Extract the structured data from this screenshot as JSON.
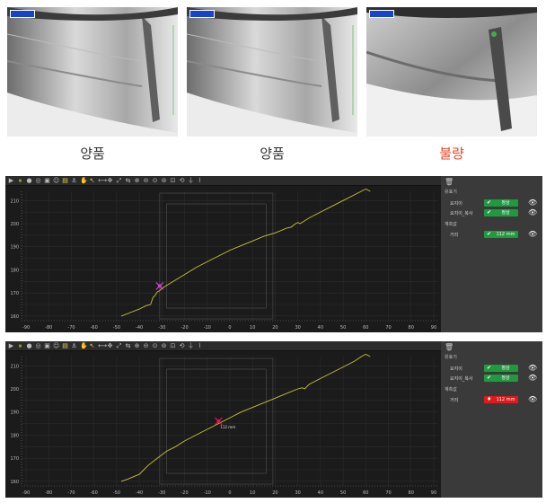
{
  "photos": [
    {
      "verdict": "양품",
      "status": "ok"
    },
    {
      "verdict": "양품",
      "status": "ok"
    },
    {
      "verdict": "불량",
      "status": "ng"
    }
  ],
  "colors": {
    "ok": "#1f9a3e",
    "ng": "#e0191c",
    "curve": "#c9c23a",
    "bad_text": "#e8472b"
  },
  "toolbar": {
    "icons": [
      "play-icon",
      "pause-icon",
      "record-icon",
      "camera-icon",
      "save-icon",
      "user-icon",
      "layout-icon",
      "anchor-icon",
      "hand-icon",
      "pointer-icon",
      "measure-icon",
      "pan-icon",
      "fit-icon",
      "align-icon",
      "zoom-in-icon",
      "zoom-out-icon",
      "zoom-x-icon",
      "zoom-y-icon",
      "zoom-box-icon",
      "zoom-reset-icon",
      "filter-icon",
      "trigger-icon"
    ]
  },
  "panels": [
    {
      "sections": {
        "detect": "유효기",
        "measure": "계측값"
      },
      "rows": [
        {
          "label": "요지이",
          "value": "정상",
          "status": "ok"
        },
        {
          "label": "요지이_복사",
          "value": "정상",
          "status": "ok"
        }
      ],
      "measure_row": {
        "label": "거리",
        "value": "112 mm",
        "status": "ok"
      },
      "marker_label": "",
      "chart_data": {
        "type": "line",
        "x_ticks": [
          "-90",
          "-80",
          "-70",
          "-60",
          "-50",
          "-40",
          "-30",
          "-20",
          "-10",
          "0",
          "10",
          "20",
          "30",
          "40",
          "50",
          "60",
          "70",
          "80",
          "90"
        ],
        "y_ticks": [
          "160",
          "170",
          "180",
          "190",
          "200",
          "210"
        ],
        "xlim": [
          -92,
          92
        ],
        "ylim": [
          158,
          214
        ],
        "marker": {
          "x": -31,
          "y": 173
        },
        "series": [
          {
            "x": [
              -48,
              -44,
              -40,
              -37,
              -35,
              -34,
              -33,
              -32,
              -31,
              -30,
              -25,
              -20,
              -15,
              -10,
              -5,
              0,
              5,
              10,
              15,
              20,
              25,
              27,
              29,
              30,
              31,
              35,
              40,
              45,
              50,
              55,
              58,
              60,
              62
            ],
            "y": [
              160,
              161.5,
              163,
              164.5,
              165,
              168,
              169,
              170.5,
              171,
              172,
              175,
              178,
              181,
              183.5,
              186,
              188.5,
              190.5,
              192.5,
              194.5,
              196,
              198,
              198.5,
              200,
              200.5,
              200,
              202.5,
              205,
              207.5,
              210,
              212.5,
              214,
              215,
              214
            ]
          }
        ]
      }
    },
    {
      "sections": {
        "detect": "유효기",
        "measure": "계측값"
      },
      "rows": [
        {
          "label": "요지이",
          "value": "정상",
          "status": "ok"
        },
        {
          "label": "요지이_복사",
          "value": "정상",
          "status": "ok"
        }
      ],
      "measure_row": {
        "label": "거리",
        "value": "112 mm",
        "status": "ng"
      },
      "marker_label": "112 mm",
      "chart_data": {
        "type": "line",
        "x_ticks": [
          "-90",
          "-80",
          "-70",
          "-60",
          "-50",
          "-40",
          "-30",
          "-20",
          "-10",
          "0",
          "10",
          "20",
          "30",
          "40",
          "50",
          "60",
          "70",
          "80",
          "90"
        ],
        "y_ticks": [
          "160",
          "170",
          "180",
          "190",
          "200",
          "210"
        ],
        "xlim": [
          -92,
          92
        ],
        "ylim": [
          158,
          214
        ],
        "marker": {
          "x": -5,
          "y": 186
        },
        "series": [
          {
            "x": [
              -48,
              -45,
              -40,
              -38,
              -36,
              -32,
              -28,
              -24,
              -20,
              -15,
              -10,
              -5,
              0,
              5,
              10,
              15,
              20,
              25,
              30,
              32,
              33,
              35,
              40,
              45,
              50,
              55,
              58,
              60,
              62
            ],
            "y": [
              160,
              161,
              163,
              165,
              167,
              170,
              173,
              175,
              177.5,
              180,
              182.5,
              185,
              187.5,
              190,
              192,
              194,
              196,
              198,
              200,
              200.5,
              200,
              202,
              204.5,
              207,
              209.5,
              212,
              214,
              215,
              214
            ]
          }
        ]
      }
    }
  ]
}
